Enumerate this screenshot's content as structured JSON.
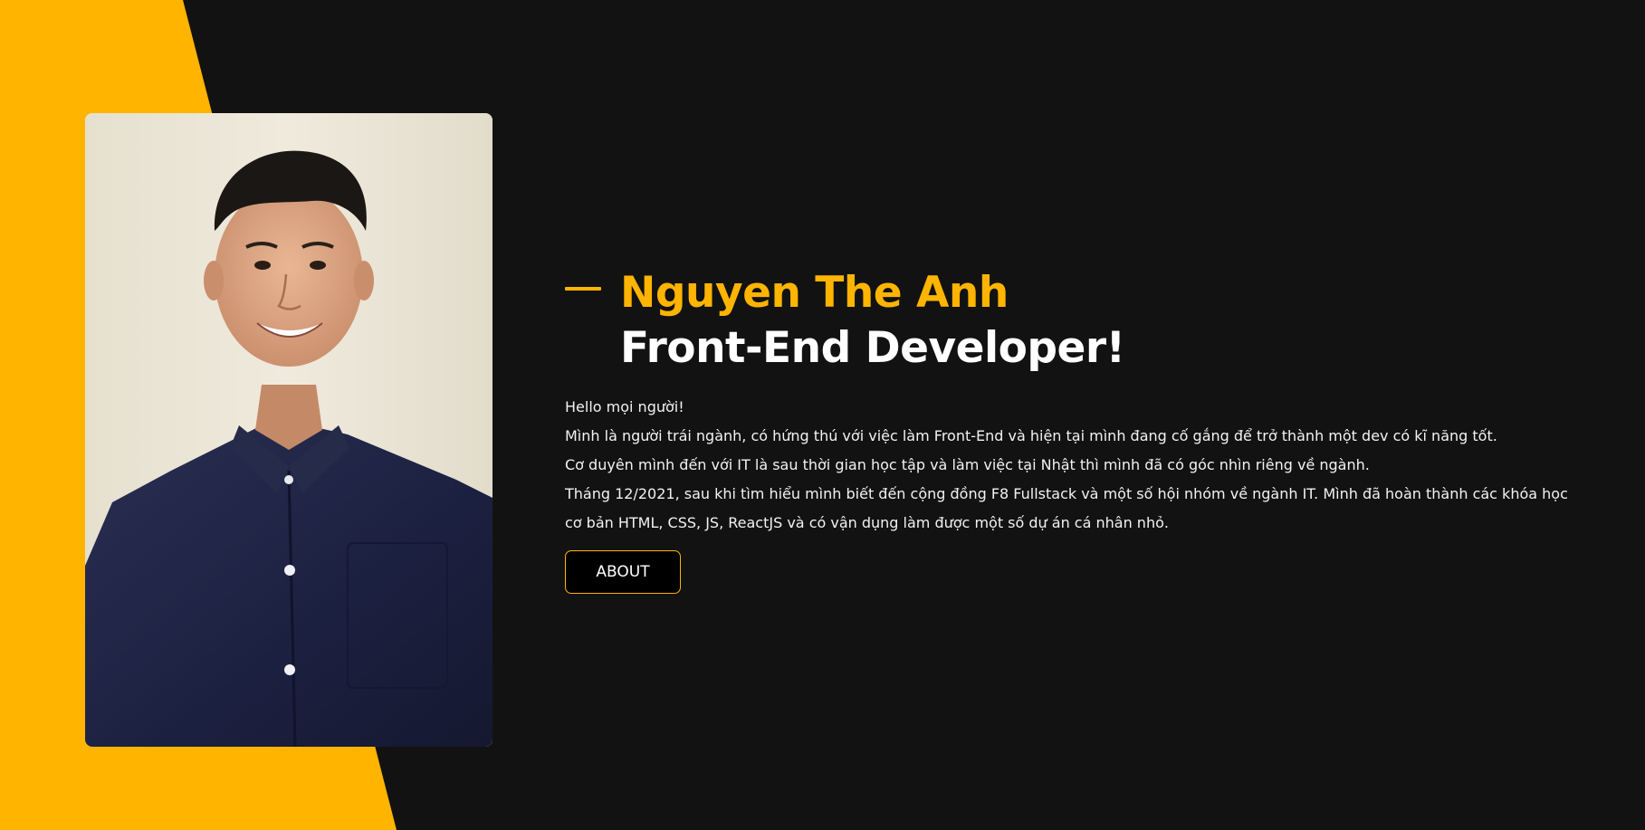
{
  "colors": {
    "accent": "#ffb400",
    "background": "#121212",
    "text": "#ffffff"
  },
  "hero": {
    "photo_alt": "Portrait photo",
    "name": "Nguyen The Anh",
    "role": "Front-End Developer!",
    "bio": [
      "Hello mọi người!",
      "Mình là người trái ngành, có hứng thú với việc làm Front-End và hiện tại mình đang cố gắng để trở thành một dev có kĩ năng tốt.",
      "Cơ duyên mình đến với IT là sau thời gian học tập và làm việc tại Nhật thì mình đã có góc nhìn riêng về ngành.",
      "Tháng 12/2021, sau khi tìm hiểu mình biết đến cộng đồng F8 Fullstack và một số hội nhóm về ngành IT. Mình đã hoàn thành các khóa học cơ bản HTML, CSS, JS, ReactJS và có vận dụng làm được một số dự án cá nhân nhỏ."
    ],
    "about_label": "ABOUT"
  }
}
